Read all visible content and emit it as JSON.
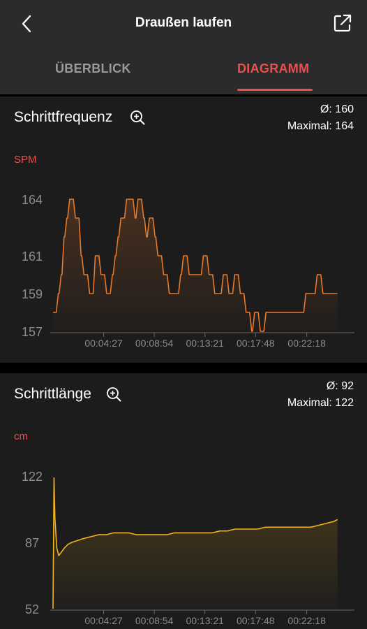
{
  "header": {
    "title": "Draußen laufen",
    "back_icon": "chevron-left-icon",
    "share_icon": "external-link-icon"
  },
  "tabs": [
    {
      "label": "ÜBERBLICK",
      "active": false
    },
    {
      "label": "DIAGRAMM",
      "active": true
    }
  ],
  "colors": {
    "accent": "#ef4e4e",
    "cadence_line": "#e8782a",
    "stride_line": "#f2b21d",
    "card_bg": "#1c1c1c",
    "header_bg": "#2b2b2b"
  },
  "cadence": {
    "title": "Schrittfrequenz",
    "avg_text": "Ø: 160",
    "max_text": "Maximal: 164",
    "unit": "SPM"
  },
  "stride": {
    "title": "Schrittlänge",
    "avg_text": "Ø: 92",
    "max_text": "Maximal: 122",
    "unit": "cm"
  },
  "chart_data": [
    {
      "type": "line",
      "title": "Schrittfrequenz",
      "ylabel": "SPM",
      "xlabel": "",
      "ylim": [
        157,
        164
      ],
      "yticks": [
        157,
        159,
        161,
        164
      ],
      "xlim": [
        0,
        1560
      ],
      "xticks": [
        267,
        534,
        801,
        1068,
        1338
      ],
      "xtick_labels": [
        "00:04:27",
        "00:08:54",
        "00:13:21",
        "00:17:48",
        "00:22:18"
      ],
      "grid": false,
      "series": [
        {
          "x": [
            0,
            15,
            30,
            45,
            60,
            75,
            90,
            105,
            120,
            135,
            150,
            165,
            180,
            195,
            210,
            225,
            240,
            255,
            270,
            285,
            300,
            315,
            330,
            345,
            360,
            375,
            390,
            405,
            420,
            435,
            450,
            465,
            480,
            495,
            510,
            525,
            540,
            555,
            570,
            585,
            600,
            615,
            630,
            645,
            660,
            675,
            690,
            705,
            720,
            735,
            750,
            765,
            780,
            795,
            810,
            825,
            840,
            855,
            870,
            885,
            900,
            915,
            930,
            945,
            960,
            975,
            990,
            1005,
            1020,
            1035,
            1050,
            1065,
            1080,
            1095,
            1110,
            1125,
            1140,
            1155,
            1170,
            1185,
            1200,
            1215,
            1230,
            1245,
            1260,
            1275,
            1290,
            1305,
            1320,
            1335,
            1350,
            1365,
            1380,
            1395,
            1410,
            1425,
            1440,
            1455,
            1470,
            1485,
            1500
          ],
          "values": [
            158,
            158,
            159,
            160,
            162,
            163,
            164,
            164,
            163,
            163,
            161,
            160,
            160,
            159,
            159,
            161,
            161,
            160,
            160,
            159,
            159,
            160,
            161,
            162,
            163,
            163,
            164,
            164,
            164,
            163,
            164,
            164,
            163,
            162,
            163,
            163,
            162,
            161,
            161,
            160,
            160,
            159,
            159,
            159,
            159,
            160,
            161,
            161,
            160,
            160,
            160,
            160,
            160,
            161,
            161,
            160,
            160,
            159,
            159,
            159,
            160,
            160,
            159,
            159,
            160,
            160,
            159,
            159,
            158,
            158,
            157,
            158,
            158,
            157,
            157,
            158,
            158,
            158,
            158,
            158,
            158,
            158,
            158,
            158,
            158,
            158,
            158,
            158,
            158,
            159,
            159,
            159,
            159,
            160,
            160,
            159,
            159,
            159,
            159,
            159,
            159
          ]
        }
      ]
    },
    {
      "type": "line",
      "title": "Schrittlänge",
      "ylabel": "cm",
      "xlabel": "",
      "ylim": [
        52,
        122
      ],
      "yticks": [
        52,
        87,
        122
      ],
      "xlim": [
        0,
        1560
      ],
      "xticks": [
        267,
        534,
        801,
        1068,
        1338
      ],
      "xtick_labels": [
        "00:04:27",
        "00:08:54",
        "00:13:21",
        "00:17:48",
        "00:22:18"
      ],
      "grid": false,
      "series": [
        {
          "x": [
            0,
            5,
            10,
            20,
            30,
            45,
            60,
            80,
            100,
            130,
            160,
            200,
            240,
            280,
            320,
            360,
            400,
            440,
            480,
            520,
            560,
            600,
            640,
            680,
            720,
            760,
            800,
            840,
            880,
            920,
            960,
            1000,
            1040,
            1080,
            1120,
            1160,
            1200,
            1240,
            1280,
            1320,
            1360,
            1400,
            1440,
            1480,
            1500
          ],
          "values": [
            52,
            121,
            100,
            84,
            80,
            82,
            84,
            86,
            87,
            88,
            89,
            90,
            91,
            91,
            92,
            92,
            92,
            91,
            91,
            91,
            91,
            91,
            92,
            92,
            92,
            92,
            92,
            92,
            93,
            93,
            94,
            94,
            94,
            94,
            95,
            95,
            95,
            95,
            95,
            95,
            95,
            96,
            97,
            98,
            99
          ]
        }
      ]
    }
  ]
}
